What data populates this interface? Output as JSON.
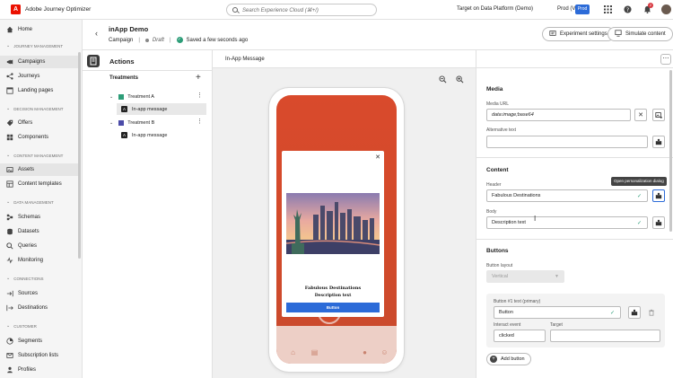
{
  "app": {
    "title": "Adobe Journey Optimizer",
    "logo_letter": "A"
  },
  "search": {
    "placeholder": "Search Experience Cloud (⌘+/)"
  },
  "topbar": {
    "org": "Target on Data Platform (Demo)",
    "sandbox": "Prod (VA7)",
    "prod_badge": "Prod",
    "notification_count": "2"
  },
  "nav": {
    "home": "Home",
    "sections": {
      "journey": "JOURNEY MANAGEMENT",
      "decision": "DECISION MANAGEMENT",
      "content": "CONTENT MANAGEMENT",
      "data": "DATA MANAGEMENT",
      "connections": "CONNECTIONS",
      "customer": "CUSTOMER"
    },
    "items": {
      "campaigns": "Campaigns",
      "journeys": "Journeys",
      "landing_pages": "Landing pages",
      "offers": "Offers",
      "components": "Components",
      "assets": "Assets",
      "content_templates": "Content templates",
      "schemas": "Schemas",
      "datasets": "Datasets",
      "queries": "Queries",
      "monitoring": "Monitoring",
      "sources": "Sources",
      "destinations": "Destinations",
      "segments": "Segments",
      "subscription_lists": "Subscription lists",
      "profiles": "Profiles"
    }
  },
  "campaign": {
    "title": "inApp Demo",
    "type": "Campaign",
    "status": "Draft",
    "saved": "Saved a few seconds ago",
    "experiment_btn": "Experiment settings",
    "simulate_btn": "Simulate content"
  },
  "actions": {
    "title": "Actions",
    "treatments_label": "Treatments",
    "treatment_a": "Treatment A",
    "treatment_b": "Treatment B",
    "message": "In-app message",
    "treatment_a_color": "#2d9d78",
    "treatment_b_color": "#4b4ba8"
  },
  "canvas": {
    "title": "In-App Message",
    "modal": {
      "header": "Fabulous Destinations",
      "body": "Description text",
      "button": "Button"
    }
  },
  "props": {
    "media": {
      "title": "Media",
      "url_label": "Media URL",
      "url_value": "data:image;base64",
      "alt_label": "Alternative text",
      "alt_value": ""
    },
    "content": {
      "title": "Content",
      "header_label": "Header",
      "header_value": "Fabulous Destinations",
      "body_label": "Body",
      "body_value": "Description text"
    },
    "buttons": {
      "title": "Buttons",
      "layout_label": "Button layout",
      "layout_value": "Vertical",
      "button1_label": "Button #1 text (primary)",
      "button1_value": "Button",
      "interact_label": "Interact event",
      "interact_value": "clicked",
      "target_label": "Target",
      "target_value": "",
      "add_label": "Add button"
    },
    "tooltip": "Open personalization dialog"
  }
}
